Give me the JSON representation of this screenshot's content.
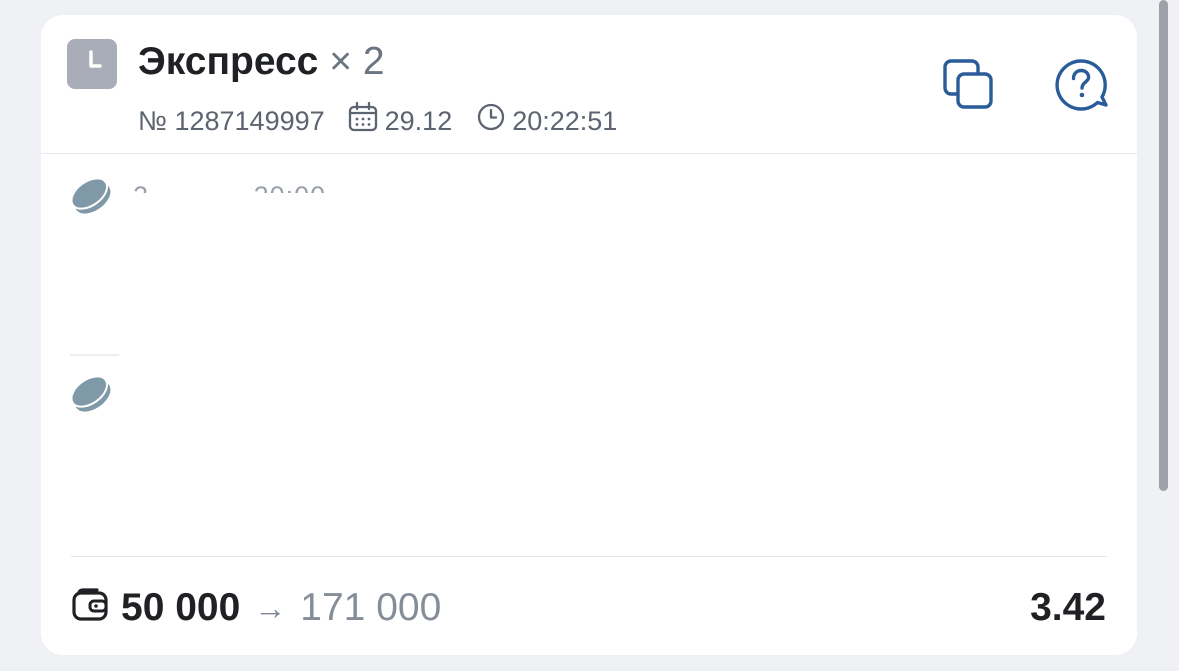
{
  "bet": {
    "type": "Экспресс",
    "multiplier": "× 2",
    "number": "№ 1287149997",
    "date": "29.12",
    "time": "20:22:51"
  },
  "events": [
    {
      "obscured_text": "2______ 20:00"
    },
    {
      "obscured_text": ""
    }
  ],
  "footer": {
    "stake": "50 000",
    "arrow": "→",
    "payout": "171 000",
    "odds": "3.42"
  },
  "icons": {
    "status": "clock-icon",
    "calendar": "calendar-icon",
    "time": "clock-icon",
    "copy": "copy-icon",
    "help": "help-bubble-icon",
    "event": "coin-icon",
    "wallet": "wallet-icon"
  },
  "colors": {
    "accent": "#2a5c9a",
    "coin": "#7f99a8",
    "status_icon_bg": "#a8adb7",
    "text_dark": "#1f2124",
    "text_muted": "#858d99"
  }
}
